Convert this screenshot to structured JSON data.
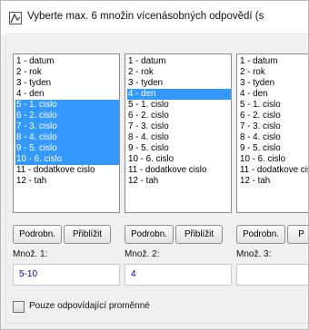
{
  "title": "Vyberte max. 6 množin vícenásobných odpovědí (s",
  "icons": {
    "app": "app-icon"
  },
  "colors": {
    "selection": "#3399ff",
    "input_text": "#0000cc"
  },
  "columns": [
    {
      "items": [
        {
          "label": "1 - datum",
          "selected": false
        },
        {
          "label": "2 - rok",
          "selected": false
        },
        {
          "label": "3 - tyden",
          "selected": false
        },
        {
          "label": "4 - den",
          "selected": false
        },
        {
          "label": "5 - 1. cislo",
          "selected": true
        },
        {
          "label": "6 - 2. cislo",
          "selected": true
        },
        {
          "label": "7 - 3. cislo",
          "selected": true
        },
        {
          "label": "8 - 4. cislo",
          "selected": true
        },
        {
          "label": "9 - 5. cislo",
          "selected": true
        },
        {
          "label": "10 - 6. cislo",
          "selected": true
        },
        {
          "label": "11 - dodatkove cislo",
          "selected": false
        },
        {
          "label": "12 - tah",
          "selected": false
        }
      ],
      "detail_label": "Podrobn.",
      "zoom_label": "Přiblížit",
      "set_label": "Množ. 1:",
      "set_value": "5-10"
    },
    {
      "items": [
        {
          "label": "1 - datum",
          "selected": false
        },
        {
          "label": "2 - rok",
          "selected": false
        },
        {
          "label": "3 - tyden",
          "selected": false
        },
        {
          "label": "4 - den",
          "selected": true
        },
        {
          "label": "5 - 1. cislo",
          "selected": false
        },
        {
          "label": "6 - 2. cislo",
          "selected": false
        },
        {
          "label": "7 - 3. cislo",
          "selected": false
        },
        {
          "label": "8 - 4. cislo",
          "selected": false
        },
        {
          "label": "9 - 5. cislo",
          "selected": false
        },
        {
          "label": "10 - 6. cislo",
          "selected": false
        },
        {
          "label": "11 - dodatkove cislo",
          "selected": false
        },
        {
          "label": "12 - tah",
          "selected": false
        }
      ],
      "detail_label": "Podrobn.",
      "zoom_label": "Přiblížit",
      "set_label": "Množ. 2:",
      "set_value": "4"
    },
    {
      "items": [
        {
          "label": "1 - datum",
          "selected": false
        },
        {
          "label": "2 - rok",
          "selected": false
        },
        {
          "label": "3 - tyden",
          "selected": false
        },
        {
          "label": "4 - den",
          "selected": false
        },
        {
          "label": "5 - 1. cislo",
          "selected": false
        },
        {
          "label": "6 - 2. cislo",
          "selected": false
        },
        {
          "label": "7 - 3. cislo",
          "selected": false
        },
        {
          "label": "8 - 4. cislo",
          "selected": false
        },
        {
          "label": "9 - 5. cislo",
          "selected": false
        },
        {
          "label": "10 - 6. cislo",
          "selected": false
        },
        {
          "label": "11 - dodatkove cislo",
          "selected": false
        },
        {
          "label": "12 - tah",
          "selected": false
        }
      ],
      "detail_label": "Podrobn.",
      "zoom_label": "P",
      "set_label": "Množ. 3:",
      "set_value": ""
    }
  ],
  "only_matching_label": "Pouze odpovídající proměnné",
  "only_matching_checked": false
}
